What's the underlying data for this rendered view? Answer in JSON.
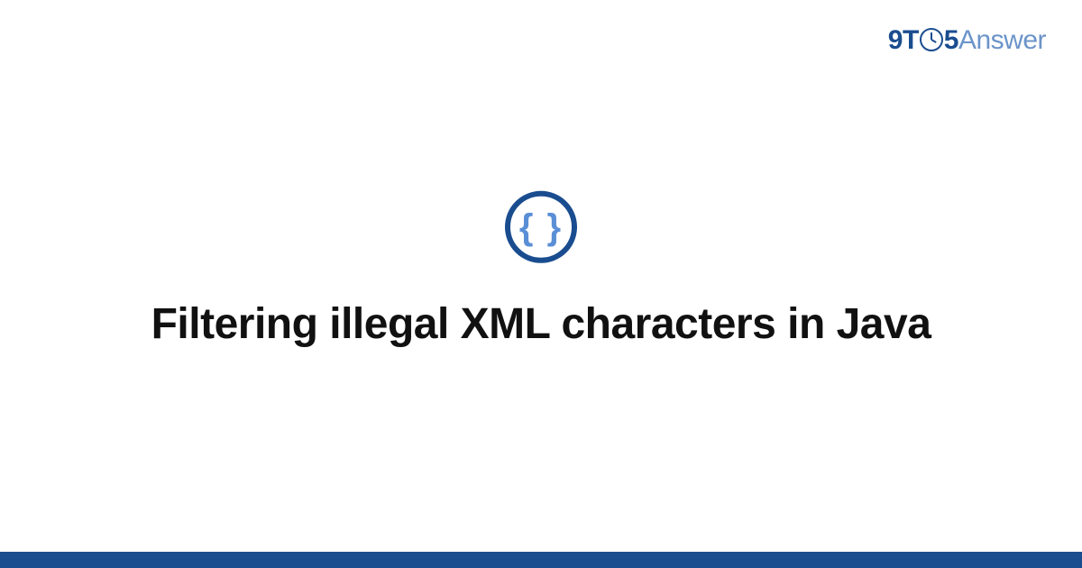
{
  "brand": {
    "nine": "9",
    "t": "T",
    "five": "5",
    "answer": "Answer"
  },
  "badge": {
    "glyph": "{ }"
  },
  "title": "Filtering illegal XML characters in Java"
}
